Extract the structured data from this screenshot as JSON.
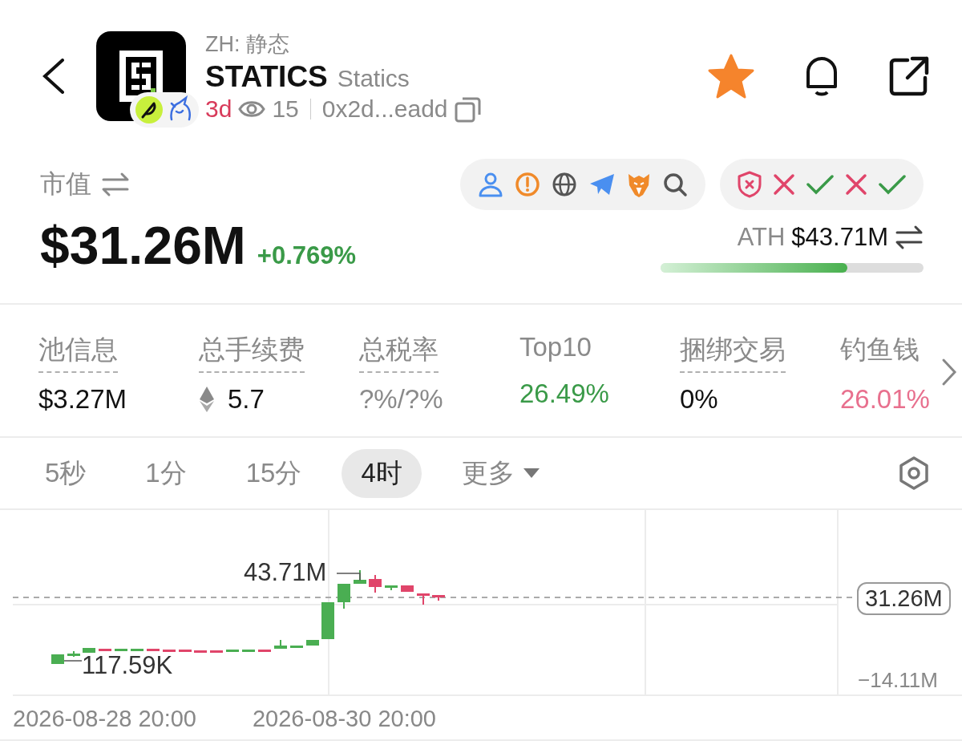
{
  "header": {
    "subtitle": "ZH: 静态",
    "symbol": "STATICS",
    "name": "Statics",
    "age": "3d",
    "views": "15",
    "address": "0x2d...eadd",
    "favorited": true
  },
  "market_cap": {
    "label": "市值",
    "value": "$31.26M",
    "change": "+0.769%",
    "ath_label": "ATH",
    "ath_value": "$43.71M",
    "ath_progress": {
      "level": 0.71
    }
  },
  "security_checks": [
    {
      "passed": false
    },
    {
      "passed": true
    },
    {
      "passed": false
    },
    {
      "passed": true
    }
  ],
  "stats": [
    {
      "label": "池信息",
      "value": "$3.27M",
      "kind": "plain",
      "color": "#111111",
      "underlined": true
    },
    {
      "label": "总手续费",
      "value": "5.7",
      "kind": "eth",
      "color": "#111111",
      "underlined": true
    },
    {
      "label": "总税率",
      "value": "?%/?%",
      "kind": "plain",
      "color": "#8a8a8a",
      "underlined": true
    },
    {
      "label": "Top10",
      "value": "26.49%",
      "kind": "plain",
      "color": "#3a9a48",
      "underlined": false
    },
    {
      "label": "捆绑交易",
      "value": "0%",
      "kind": "plain",
      "color": "#111111",
      "underlined": true
    },
    {
      "label": "钓鱼钱",
      "value": "26.01%",
      "kind": "faded",
      "color": "#e8708e",
      "underlined": false
    }
  ],
  "timeframes": [
    {
      "label": "5秒",
      "selected": false
    },
    {
      "label": "1分",
      "selected": false
    },
    {
      "label": "15分",
      "selected": false
    },
    {
      "label": "4时",
      "selected": true
    },
    {
      "label": "更多",
      "selected": false,
      "kind": "dropdown"
    }
  ],
  "chart": {
    "high_label": "43.71M",
    "low_label": "117.59K",
    "current_price": "31.26M",
    "axis_label": "−14.11M",
    "dates": [
      "2026-08-28 20:00",
      "2026-08-30 20:00"
    ]
  }
}
